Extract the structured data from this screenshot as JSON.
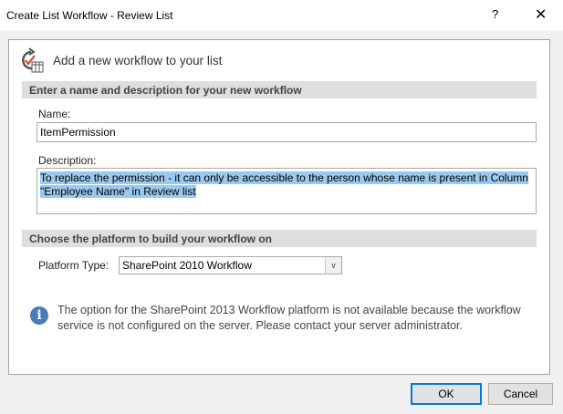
{
  "window": {
    "title": "Create List Workflow - Review List",
    "help": "?",
    "close": "✕"
  },
  "header": {
    "title": "Add a new workflow to your list"
  },
  "section1": {
    "title": "Enter a name and description for your new workflow",
    "name_label": "Name:",
    "name_value": "ItemPermission",
    "description_label": "Description:",
    "description_value": "To replace the permission - it can only be accessible to the person whose name is present in Column \"Employee Name\" in Review list"
  },
  "section2": {
    "title": "Choose the platform to build your workflow on",
    "platform_label": "Platform Type:",
    "platform_value": "SharePoint 2010 Workflow"
  },
  "info": {
    "text": "The option for the SharePoint 2013 Workflow platform is not available because the workflow service is not configured on the server. Please contact your server administrator."
  },
  "buttons": {
    "ok": "OK",
    "cancel": "Cancel"
  }
}
